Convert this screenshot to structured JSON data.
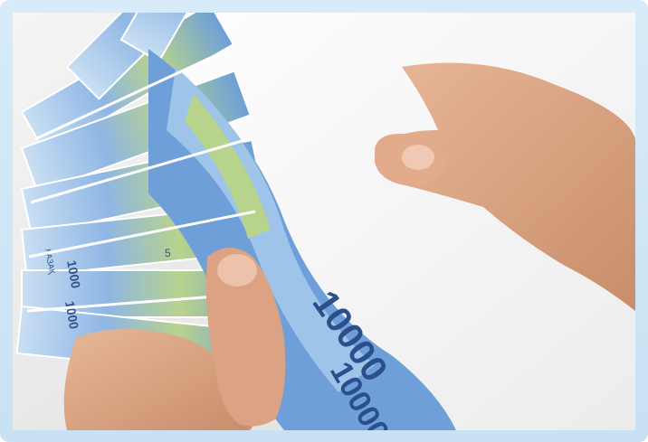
{
  "photo": {
    "subject": "hands-holding-envelope-with-banknotes",
    "colors": {
      "frame": "#cfe6f6",
      "background": "#ededed",
      "envelope": "#f9f9f9",
      "banknote_blue": "#7fa9dc",
      "banknote_green": "#b9d58a",
      "skin": "#d9a07e"
    },
    "banknote": {
      "denomination_text": "10000",
      "short_denomination_text": "1000",
      "issuer_text": "ҚАЗАҚ",
      "digit_text": "5"
    }
  }
}
